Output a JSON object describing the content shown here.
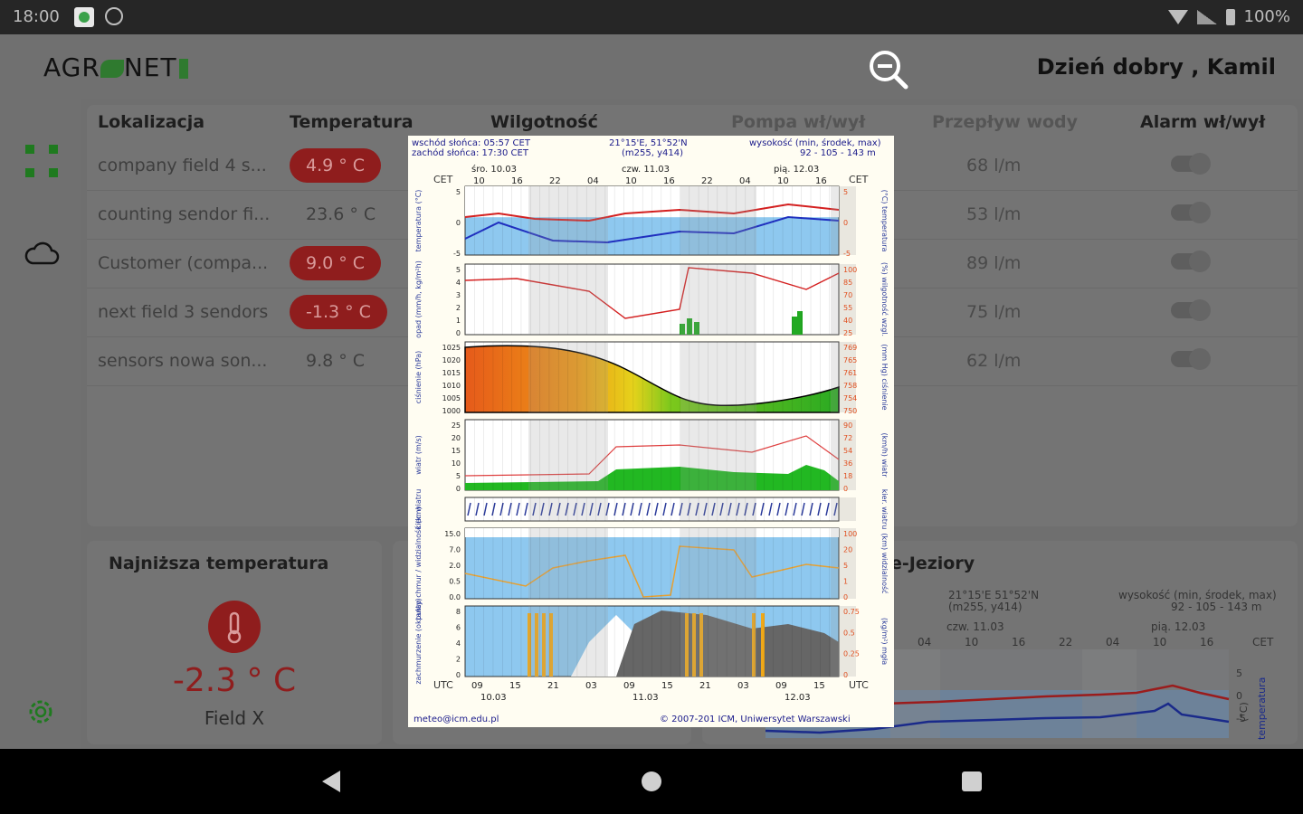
{
  "status_bar": {
    "time": "18:00",
    "battery": "100%"
  },
  "header": {
    "logo_text_a": "AGR",
    "logo_text_b": "NET",
    "greeting": "Dzień dobry , Kamil"
  },
  "table": {
    "headers": [
      "Lokalizacja",
      "Temperatura",
      "Wilgotność",
      "Pompa wł/wył",
      "Przepływ wody",
      "Alarm wł/wył"
    ],
    "rows": [
      {
        "name": "company field 4 s...",
        "temp": "4.9 ° C",
        "alert": true,
        "flow": "68 l/m"
      },
      {
        "name": "counting sendor fi...",
        "temp": "23.6 ° C",
        "alert": false,
        "flow": "53 l/m"
      },
      {
        "name": "Customer (compa...",
        "temp": "9.0 ° C",
        "alert": true,
        "flow": "89 l/m"
      },
      {
        "name": "next field 3 sendors",
        "temp": "-1.3 ° C",
        "alert": true,
        "flow": "75 l/m"
      },
      {
        "name": "sensors nowa son...",
        "temp": "9.8 ° C",
        "alert": false,
        "flow": "62 l/m"
      }
    ]
  },
  "min_temp": {
    "title": "Najniższa temperatura",
    "value": "-2.3 ° C",
    "field": "Field X"
  },
  "right_card": {
    "title": "e-Jeziory",
    "coords": "21°15'E 51°52'N",
    "grid": "(m255, y414)",
    "height_label": "wysokość (min, środek, max)",
    "height_values": "92 - 105 - 143 m",
    "day_a": "czw. 11.03",
    "day_b": "pią. 12.03",
    "cet": "CET",
    "hours": [
      "04",
      "10",
      "16",
      "22",
      "04",
      "10",
      "16"
    ],
    "yticks": [
      "5",
      "0",
      "-5"
    ],
    "axis": "(°C)",
    "axis2": "temperatura"
  },
  "meteogram": {
    "sunrise": "wschód słońca: 05:57 CET",
    "sunset": "zachód słońca: 17:30 CET",
    "coords": "21°15'E, 51°52'N",
    "grid": "(m255, y414)",
    "height_label": "wysokość (min, środek, max)",
    "height_values": "92 - 105 - 143 m",
    "cet": "CET",
    "utc": "UTC",
    "day_labels": [
      "śro. 10.03",
      "czw. 11.03",
      "pią. 12.03"
    ],
    "top_hours": [
      "10",
      "16",
      "22",
      "04",
      "10",
      "16",
      "22",
      "04",
      "10",
      "16"
    ],
    "bottom_hours": [
      "09",
      "15",
      "21",
      "03",
      "09",
      "15",
      "21",
      "03",
      "09",
      "15"
    ],
    "bottom_dates": [
      "10.03",
      "11.03",
      "12.03"
    ],
    "footer_email": "meteo@icm.edu.pl",
    "footer_copy": "© 2007-201 ICM, Uniwersytet Warszawski",
    "panels": [
      {
        "left": "temperatura (°C)",
        "right": "(°C) temperatura",
        "ticks_left": [
          "5",
          "0",
          "-5"
        ],
        "ticks_right": [
          "5",
          "0",
          "-5"
        ]
      },
      {
        "left": "opad (mm/h, kg/m²h)",
        "right": "(%) wilgotność wzgl.",
        "ticks_left": [
          "5",
          "4",
          "3",
          "2",
          "1",
          "0"
        ],
        "ticks_right": [
          "100",
          "85",
          "70",
          "55",
          "40",
          "25"
        ]
      },
      {
        "left": "ciśnienie (hPa)",
        "right": "(mm Hg) ciśnienie",
        "ticks_left": [
          "1025",
          "1020",
          "1015",
          "1010",
          "1005",
          "1000"
        ],
        "ticks_right": [
          "769",
          "765",
          "761",
          "758",
          "754",
          "750"
        ]
      },
      {
        "left": "wiatr (m/s)",
        "right": "(km/h) wiatr",
        "ticks_left": [
          "25",
          "20",
          "15",
          "10",
          "5",
          "0"
        ],
        "ticks_right": [
          "90",
          "72",
          "54",
          "36",
          "18",
          "0"
        ]
      },
      {
        "left": "kier. wiatru",
        "right": "kier. wiatru",
        "ticks_left": [],
        "ticks_right": []
      },
      {
        "left": "pułap chmur / widzialność (km)",
        "right": "(km) widzialność",
        "ticks_left": [
          "15.0",
          "7.0",
          "2.0",
          "0.5",
          "0.0"
        ],
        "ticks_right": [
          "100",
          "20",
          "5",
          "1",
          "0"
        ]
      },
      {
        "left": "zachmurzenie (oktanty)",
        "right": "(kg/m²) mgła",
        "ticks_left": [
          "8",
          "6",
          "4",
          "2",
          "0"
        ],
        "ticks_right": [
          "0.75",
          "0.5",
          "0.25",
          "0"
        ]
      }
    ]
  }
}
